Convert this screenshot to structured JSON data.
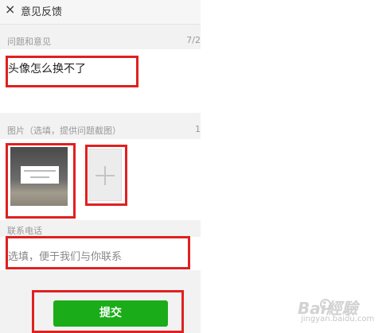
{
  "header": {
    "close_glyph": "×",
    "title": "意见反馈"
  },
  "feedback": {
    "label": "问题和意见",
    "counter": "7/2",
    "value": "头像怎么换不了"
  },
  "images": {
    "label": "图片（选填，提供问题截图）",
    "counter": "1"
  },
  "contact": {
    "label": "联系电话",
    "placeholder": "选填，便于我们与你联系"
  },
  "submit": {
    "label": "提交"
  },
  "watermark": {
    "brand": "Bai經驗",
    "sub": "jingyan.baidu.com"
  },
  "colors": {
    "accent_green": "#1aad19",
    "highlight_red": "#e02020"
  }
}
